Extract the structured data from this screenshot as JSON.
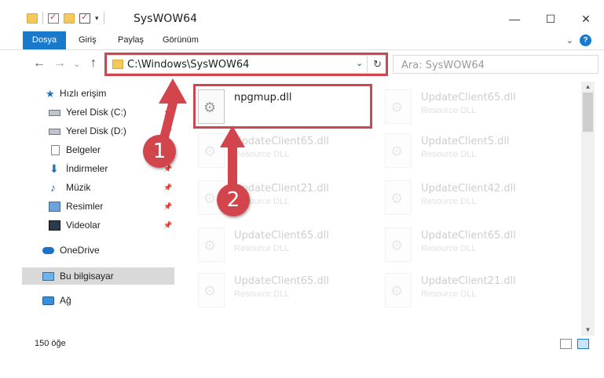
{
  "window": {
    "title": "SysWOW64",
    "controls": {
      "minimize": "—",
      "maximize": "☐",
      "close": "✕"
    }
  },
  "ribbon": {
    "tabs": [
      {
        "label": "Dosya"
      },
      {
        "label": "Giriş"
      },
      {
        "label": "Paylaş"
      },
      {
        "label": "Görünüm"
      }
    ],
    "help": "?",
    "collapse": "⌄"
  },
  "navigation": {
    "back": "←",
    "forward": "→",
    "recent": "⌄",
    "up": "↑",
    "address": "C:\\Windows\\SysWOW64",
    "address_dropdown": "⌄",
    "refresh": "↻",
    "search_placeholder": "Ara: SysWOW64"
  },
  "sidebar": {
    "items": [
      {
        "label": "Hızlı erişim",
        "icon": "star-icon"
      },
      {
        "label": "Yerel Disk (C:)",
        "icon": "drive-icon",
        "pinned": true
      },
      {
        "label": "Yerel Disk (D:)",
        "icon": "drive-icon",
        "pinned": true
      },
      {
        "label": "Belgeler",
        "icon": "document-icon",
        "pinned": true
      },
      {
        "label": "İndirmeler",
        "icon": "download-icon",
        "pinned": true
      },
      {
        "label": "Müzik",
        "icon": "music-icon",
        "pinned": true
      },
      {
        "label": "Resimler",
        "icon": "pictures-icon",
        "pinned": true
      },
      {
        "label": "Videolar",
        "icon": "video-icon",
        "pinned": true
      },
      {
        "label": "OneDrive",
        "icon": "cloud-icon"
      },
      {
        "label": "Bu bilgisayar",
        "icon": "computer-icon",
        "selected": true
      },
      {
        "label": "Ağ",
        "icon": "network-icon"
      }
    ],
    "pin_glyph": "📌"
  },
  "files": [
    {
      "name": "npgmup.dll",
      "type": "",
      "highlighted": true
    },
    {
      "name": "UpdateClient65.dll",
      "type": "Resource DLL"
    },
    {
      "name": "UpdateClient65.dll",
      "type": "Resource DLL"
    },
    {
      "name": "UpdateClient5.dll",
      "type": "Resource DLL"
    },
    {
      "name": "UpdateClient21.dll",
      "type": "Resource DLL"
    },
    {
      "name": "UpdateClient42.dll",
      "type": "Resource DLL"
    },
    {
      "name": "UpdateClient65.dll",
      "type": "Resource DLL"
    },
    {
      "name": "UpdateClient65.dll",
      "type": "Resource DLL"
    },
    {
      "name": "UpdateClient65.dll",
      "type": "Resource DLL"
    },
    {
      "name": "UpdateClient21.dll",
      "type": "Resource DLL"
    }
  ],
  "status": {
    "item_count": "150 öğe"
  },
  "callouts": {
    "step1": "1",
    "step2": "2"
  },
  "colors": {
    "accent": "#1979ca",
    "callout": "#d3454d",
    "folder": "#f3c95b"
  }
}
